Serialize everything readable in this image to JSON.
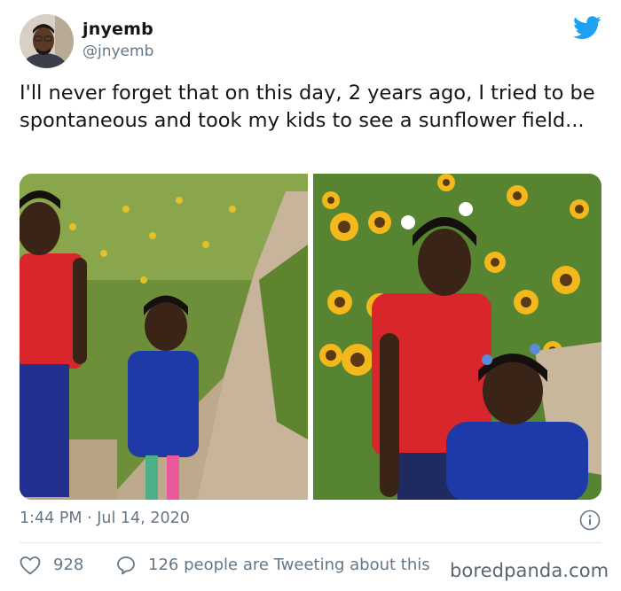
{
  "user": {
    "display_name": "jnyemb",
    "handle": "@jnyemb"
  },
  "tweet": {
    "text": "I'll never forget that on this day, 2 years ago, I tried to be spontaneous and took my kids to see a sunflower field..."
  },
  "media": [
    {
      "description_icon": "photo-path-field"
    },
    {
      "description_icon": "photo-sunflower-field"
    }
  ],
  "meta": {
    "time": "1:44 PM",
    "separator": "·",
    "date": "Jul 14, 2020"
  },
  "actions": {
    "like_count": "928",
    "reply_text": "126 people are Tweeting about this"
  },
  "watermark": "boredpanda.com",
  "colors": {
    "twitter_blue": "#1da1f2",
    "secondary_text": "#657786",
    "divider": "#e1e8ed"
  },
  "icons": [
    "twitter-bird-icon",
    "info-icon",
    "heart-icon",
    "speech-bubble-icon"
  ]
}
